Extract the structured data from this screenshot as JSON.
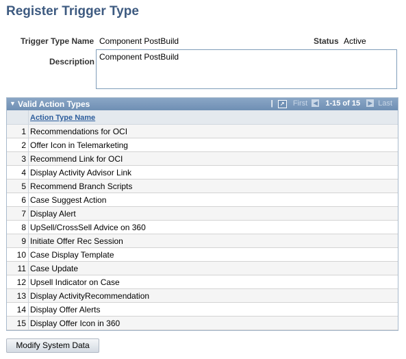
{
  "page": {
    "title": "Register Trigger Type"
  },
  "form": {
    "trigger_type_name_label": "Trigger Type Name",
    "trigger_type_name_value": "Component PostBuild",
    "status_label": "Status",
    "status_value": "Active",
    "description_label": "Description",
    "description_value": "Component PostBuild"
  },
  "grid": {
    "title": "Valid Action Types",
    "nav": {
      "first": "First",
      "count": "1-15 of 15",
      "last": "Last"
    },
    "column_header": "Action Type Name",
    "rows": [
      {
        "n": "1",
        "name": "Recommendations for OCI"
      },
      {
        "n": "2",
        "name": "Offer Icon in Telemarketing"
      },
      {
        "n": "3",
        "name": "Recommend Link for OCI"
      },
      {
        "n": "4",
        "name": "Display Activity Advisor Link"
      },
      {
        "n": "5",
        "name": "Recommend Branch Scripts"
      },
      {
        "n": "6",
        "name": "Case Suggest Action"
      },
      {
        "n": "7",
        "name": "Display Alert"
      },
      {
        "n": "8",
        "name": "UpSell/CrossSell Advice on 360"
      },
      {
        "n": "9",
        "name": "Initiate Offer Rec Session"
      },
      {
        "n": "10",
        "name": "Case Display Template"
      },
      {
        "n": "11",
        "name": "Case Update"
      },
      {
        "n": "12",
        "name": "Upsell Indicator on Case"
      },
      {
        "n": "13",
        "name": "Display ActivityRecommendation"
      },
      {
        "n": "14",
        "name": "Display Offer Alerts"
      },
      {
        "n": "15",
        "name": "Display Offer Icon in 360"
      }
    ]
  },
  "buttons": {
    "modify": "Modify System Data"
  }
}
